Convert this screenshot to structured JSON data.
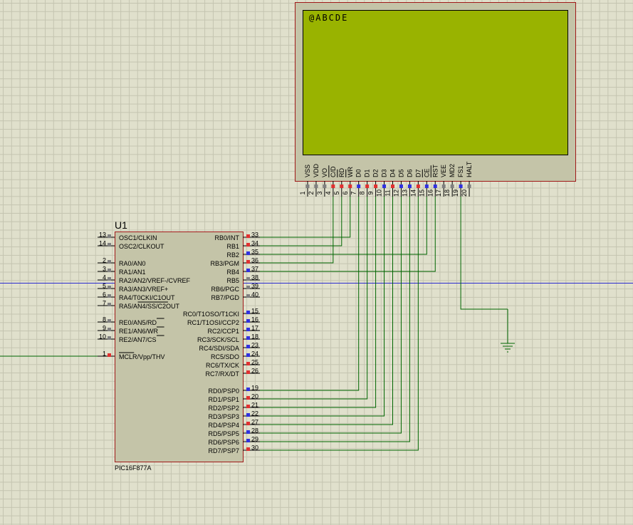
{
  "schematic": {
    "mcu": {
      "ref": "U1",
      "part": "PIC16F877A",
      "left_pins": [
        {
          "num": "13",
          "name": "OSC1/CLKIN",
          "color": "#808080"
        },
        {
          "num": "14",
          "name": "OSC2/CLKOUT",
          "color": "#808080"
        },
        {
          "num": "2",
          "name": "RA0/AN0",
          "color": "#808080"
        },
        {
          "num": "3",
          "name": "RA1/AN1",
          "color": "#808080"
        },
        {
          "num": "4",
          "name": "RA2/AN2/VREF-/CVREF",
          "color": "#808080"
        },
        {
          "num": "5",
          "name": "RA3/AN3/VREF+",
          "color": "#808080"
        },
        {
          "num": "6",
          "name": "RA4/T0CKI/C1OUT",
          "color": "#808080"
        },
        {
          "num": "7",
          "name": "RA5/AN4/SS/C2OUT",
          "color": "#808080"
        },
        {
          "num": "8",
          "name": "RE0/AN5/RD",
          "color": "#808080"
        },
        {
          "num": "9",
          "name": "RE1/AN6/WR",
          "color": "#808080"
        },
        {
          "num": "10",
          "name": "RE2/AN7/CS",
          "color": "#808080"
        },
        {
          "num": "1",
          "name": "MCLR/Vpp/THV",
          "color": "#e03030"
        }
      ],
      "right_pins": [
        {
          "num": "33",
          "name": "RB0/INT",
          "color": "#e03030"
        },
        {
          "num": "34",
          "name": "RB1",
          "color": "#e03030"
        },
        {
          "num": "35",
          "name": "RB2",
          "color": "#3030e0"
        },
        {
          "num": "36",
          "name": "RB3/PGM",
          "color": "#e03030"
        },
        {
          "num": "37",
          "name": "RB4",
          "color": "#3030e0"
        },
        {
          "num": "38",
          "name": "RB5",
          "color": "#808080"
        },
        {
          "num": "39",
          "name": "RB6/PGC",
          "color": "#808080"
        },
        {
          "num": "40",
          "name": "RB7/PGD",
          "color": "#808080"
        },
        {
          "num": "15",
          "name": "RC0/T1OSO/T1CKI",
          "color": "#3030e0"
        },
        {
          "num": "16",
          "name": "RC1/T1OSI/CCP2",
          "color": "#3030e0"
        },
        {
          "num": "17",
          "name": "RC2/CCP1",
          "color": "#3030e0"
        },
        {
          "num": "18",
          "name": "RC3/SCK/SCL",
          "color": "#3030e0"
        },
        {
          "num": "23",
          "name": "RC4/SDI/SDA",
          "color": "#3030e0"
        },
        {
          "num": "24",
          "name": "RC5/SDO",
          "color": "#3030e0"
        },
        {
          "num": "25",
          "name": "RC6/TX/CK",
          "color": "#e03030"
        },
        {
          "num": "26",
          "name": "RC7/RX/DT",
          "color": "#e03030"
        },
        {
          "num": "19",
          "name": "RD0/PSP0",
          "color": "#3030e0"
        },
        {
          "num": "20",
          "name": "RD1/PSP1",
          "color": "#e03030"
        },
        {
          "num": "21",
          "name": "RD2/PSP2",
          "color": "#e03030"
        },
        {
          "num": "22",
          "name": "RD3/PSP3",
          "color": "#3030e0"
        },
        {
          "num": "27",
          "name": "RD4/PSP4",
          "color": "#e03030"
        },
        {
          "num": "28",
          "name": "RD5/PSP5",
          "color": "#3030e0"
        },
        {
          "num": "29",
          "name": "RD6/PSP6",
          "color": "#3030e0"
        },
        {
          "num": "30",
          "name": "RD7/PSP7",
          "color": "#e03030"
        }
      ]
    },
    "lcd": {
      "display_text": "@ABCDE",
      "screen_color": "#99b300",
      "pins": [
        {
          "num": "1",
          "name": "VSS",
          "color": "#808080"
        },
        {
          "num": "2",
          "name": "VDD",
          "color": "#808080"
        },
        {
          "num": "3",
          "name": "VO",
          "color": "#808080"
        },
        {
          "num": "4",
          "name": "C/D",
          "color": "#e03030"
        },
        {
          "num": "5",
          "name": "RD",
          "color": "#e03030"
        },
        {
          "num": "6",
          "name": "WR",
          "color": "#e03030"
        },
        {
          "num": "7",
          "name": "D0",
          "color": "#3030e0"
        },
        {
          "num": "8",
          "name": "D1",
          "color": "#e03030"
        },
        {
          "num": "9",
          "name": "D2",
          "color": "#e03030"
        },
        {
          "num": "10",
          "name": "D3",
          "color": "#3030e0"
        },
        {
          "num": "11",
          "name": "D4",
          "color": "#e03030"
        },
        {
          "num": "12",
          "name": "D5",
          "color": "#3030e0"
        },
        {
          "num": "13",
          "name": "D6",
          "color": "#3030e0"
        },
        {
          "num": "14",
          "name": "D7",
          "color": "#e03030"
        },
        {
          "num": "15",
          "name": "CE",
          "color": "#3030e0"
        },
        {
          "num": "16",
          "name": "RST",
          "color": "#3030e0"
        },
        {
          "num": "17",
          "name": "VEE",
          "color": "#808080"
        },
        {
          "num": "18",
          "name": "MD2",
          "color": "#808080"
        },
        {
          "num": "19",
          "name": "FS1",
          "color": "#3030e0"
        },
        {
          "num": "20",
          "name": "HALT",
          "color": "#808080"
        }
      ]
    }
  }
}
